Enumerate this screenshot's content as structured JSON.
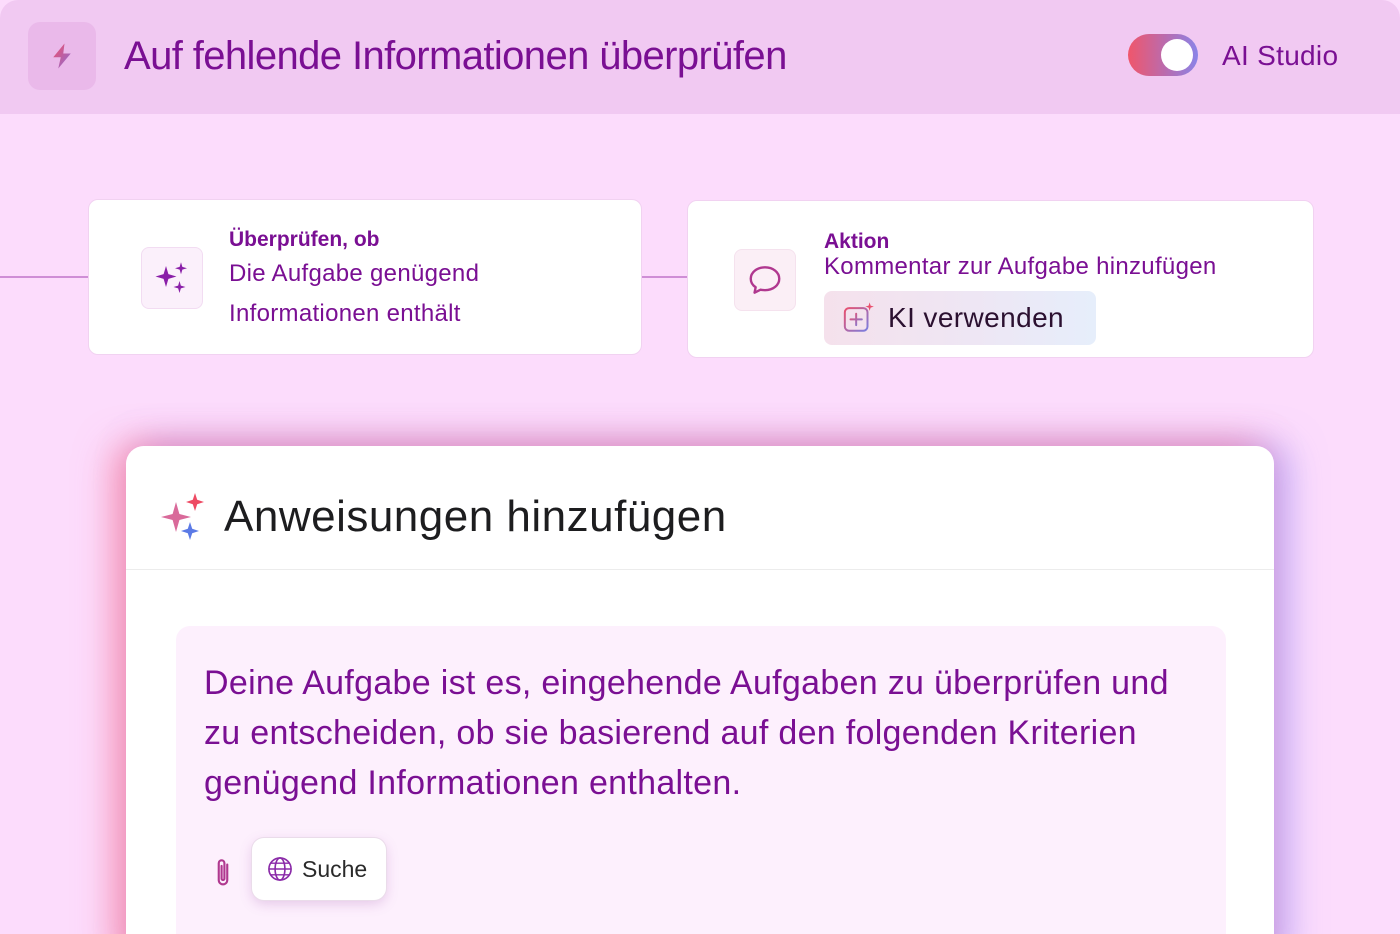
{
  "header": {
    "title": "Auf fehlende Informationen überprüfen",
    "toggle_label": "AI Studio",
    "toggle_on": true
  },
  "flow": {
    "condition_card": {
      "heading": "Überprüfen, ob",
      "line1": "Die Aufgabe genügend",
      "line2": "Informationen enthält"
    },
    "action_card": {
      "heading": "Aktion",
      "text": "Kommentar zur Aufgabe hinzufügen",
      "ki_button_label": "KI verwenden"
    }
  },
  "instructions": {
    "title": "Anweisungen hinzufügen",
    "prompt": "Deine Aufgabe ist es, eingehende Aufgaben zu überprüfen und zu entscheiden, ob sie basierend auf den folgenden Kriterien genügend Informationen enthalten.",
    "search_label": "Suche"
  },
  "icons": {
    "header": "lightning-icon",
    "condition": "sparkles-icon",
    "action": "comment-icon",
    "ki": "ai-plus-icon",
    "panel": "sparkles-icon",
    "attach": "paperclip-icon",
    "search": "globe-icon"
  },
  "colors": {
    "accent": "#7a0f93",
    "background": "#fcdcfc",
    "header_bg": "#f1c9f2"
  }
}
